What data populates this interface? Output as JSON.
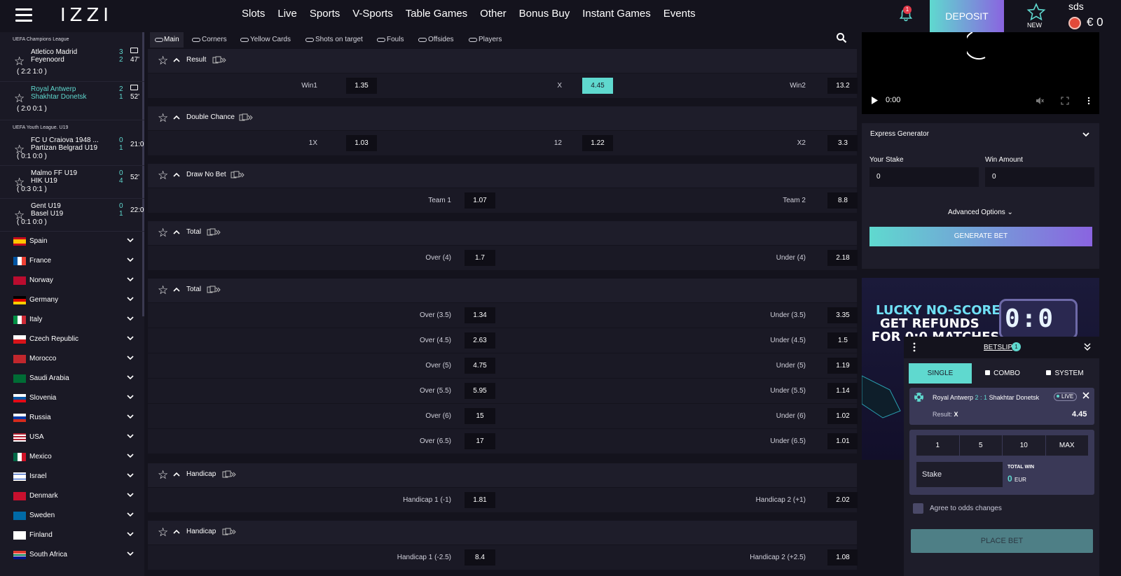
{
  "header": {
    "logo": "IZZI",
    "nav": [
      "Slots",
      "Live",
      "Sports",
      "V-Sports",
      "Table Games",
      "Other",
      "Bonus Buy",
      "Instant Games",
      "Events"
    ],
    "notification_count": "1",
    "deposit_label": "DEPOSIT",
    "new_label": "NEW",
    "username": "sds",
    "balance": "€ 0"
  },
  "sidebar": {
    "leagues": [
      {
        "name": "UEFA Champions League",
        "matches": [
          {
            "team1": "Atletico Madrid",
            "team2": "Feyenoord",
            "score1": "3",
            "score2": "2",
            "time": "47'",
            "detail": "( 2:2  1:0 )"
          },
          {
            "team1": "Royal Antwerp",
            "team2": "Shakhtar Donetsk",
            "score1": "2",
            "score2": "1",
            "time": "52'",
            "detail": "( 2:0  0:1 )"
          }
        ]
      },
      {
        "name": "UEFA Youth League. U19",
        "matches": [
          {
            "team1": "FC U Craiova 1948 ...",
            "team2": "Partizan Belgrad U19",
            "score1": "0",
            "score2": "1",
            "time": "21:00",
            "detail": "( 0:1  0:0 )"
          },
          {
            "team1": "Malmo FF U19",
            "team2": "HIK U19",
            "score1": "0",
            "score2": "4",
            "time": "52'",
            "detail": "( 0:3  0:1 )"
          },
          {
            "team1": "Gent U19",
            "team2": "Basel U19",
            "score1": "0",
            "score2": "1",
            "time": "22:00",
            "detail": "( 0:1  0:0 )"
          }
        ]
      }
    ],
    "countries": [
      "Spain",
      "France",
      "Norway",
      "Germany",
      "Italy",
      "Czech Republic",
      "Morocco",
      "Saudi Arabia",
      "Slovenia",
      "Russia",
      "USA",
      "Mexico",
      "Israel",
      "Denmark",
      "Sweden",
      "Finland",
      "South Africa"
    ]
  },
  "markets_tabs": [
    "Main",
    "Corners",
    "Yellow Cards",
    "Shots on target",
    "Fouls",
    "Offsides",
    "Players"
  ],
  "markets": [
    {
      "title": "Result",
      "rows": [
        [
          {
            "label": "Win1",
            "odd": "1.35"
          },
          {
            "label": "X",
            "odd": "4.45"
          },
          {
            "label": "Win2",
            "odd": "13.2"
          }
        ]
      ]
    },
    {
      "title": "Double Chance",
      "rows": [
        [
          {
            "label": "1X",
            "odd": "1.03"
          },
          {
            "label": "12",
            "odd": "1.22"
          },
          {
            "label": "X2",
            "odd": "3.3"
          }
        ]
      ]
    },
    {
      "title": "Draw No Bet",
      "rows": [
        [
          {
            "label": "Team 1",
            "odd": "1.07"
          },
          {
            "label": "Team 2",
            "odd": "8.8"
          }
        ]
      ]
    },
    {
      "title": "Total",
      "rows": [
        [
          {
            "label": "Over (4)",
            "odd": "1.7"
          },
          {
            "label": "Under (4)",
            "odd": "2.18"
          }
        ]
      ]
    },
    {
      "title": "Total",
      "rows": [
        [
          {
            "label": "Over (3.5)",
            "odd": "1.34"
          },
          {
            "label": "Under (3.5)",
            "odd": "3.35"
          }
        ],
        [
          {
            "label": "Over (4.5)",
            "odd": "2.63"
          },
          {
            "label": "Under (4.5)",
            "odd": "1.5"
          }
        ],
        [
          {
            "label": "Over (5)",
            "odd": "4.75"
          },
          {
            "label": "Under (5)",
            "odd": "1.19"
          }
        ],
        [
          {
            "label": "Over (5.5)",
            "odd": "5.95"
          },
          {
            "label": "Under (5.5)",
            "odd": "1.14"
          }
        ],
        [
          {
            "label": "Over (6)",
            "odd": "15"
          },
          {
            "label": "Under (6)",
            "odd": "1.02"
          }
        ],
        [
          {
            "label": "Over (6.5)",
            "odd": "17"
          },
          {
            "label": "Under (6.5)",
            "odd": "1.01"
          }
        ]
      ]
    },
    {
      "title": "Handicap",
      "rows": [
        [
          {
            "label": "Handicap 1 (-1)",
            "odd": "1.81"
          },
          {
            "label": "Handicap 2 (+1)",
            "odd": "2.02"
          }
        ]
      ]
    },
    {
      "title": "Handicap",
      "rows": [
        [
          {
            "label": "Handicap 1 (-2.5)",
            "odd": "8.4"
          },
          {
            "label": "Handicap 2 (+2.5)",
            "odd": "1.08"
          }
        ]
      ]
    }
  ],
  "video": {
    "time": "0:00"
  },
  "express": {
    "title": "Express Generator",
    "stake_label": "Your Stake",
    "win_label": "Win Amount",
    "stake_value": "0",
    "win_value": "0",
    "advanced": "Advanced Options",
    "generate": "GENERATE BET"
  },
  "promo": {
    "line1": "LUCKY NO-SCORES",
    "line2": "GET REFUNDS",
    "line3": "FOR 0:0 MATCHES",
    "board": "0:0"
  },
  "betslip": {
    "title": "BETSLIP",
    "count": "1",
    "tabs": [
      "SINGLE",
      "COMBO",
      "SYSTEM"
    ],
    "bet": {
      "team1": "Royal Antwerp",
      "score": "2 : 1",
      "team2": "Shakhtar Donetsk",
      "live": "LIVE",
      "result_label": "Result:",
      "result_value": "X",
      "odd": "4.45"
    },
    "quick_stakes": [
      "1",
      "5",
      "10",
      "MAX"
    ],
    "stake_placeholder": "Stake",
    "total_win_label": "TOTAL WIN",
    "total_win_value": "0",
    "currency": "EUR",
    "agree": "Agree to odds changes",
    "place": "PLACE BET"
  },
  "colors": {
    "accent": "#5fd9cf",
    "purple": "#8a64e0",
    "background": "#14131d",
    "panel": "#1a1925"
  }
}
